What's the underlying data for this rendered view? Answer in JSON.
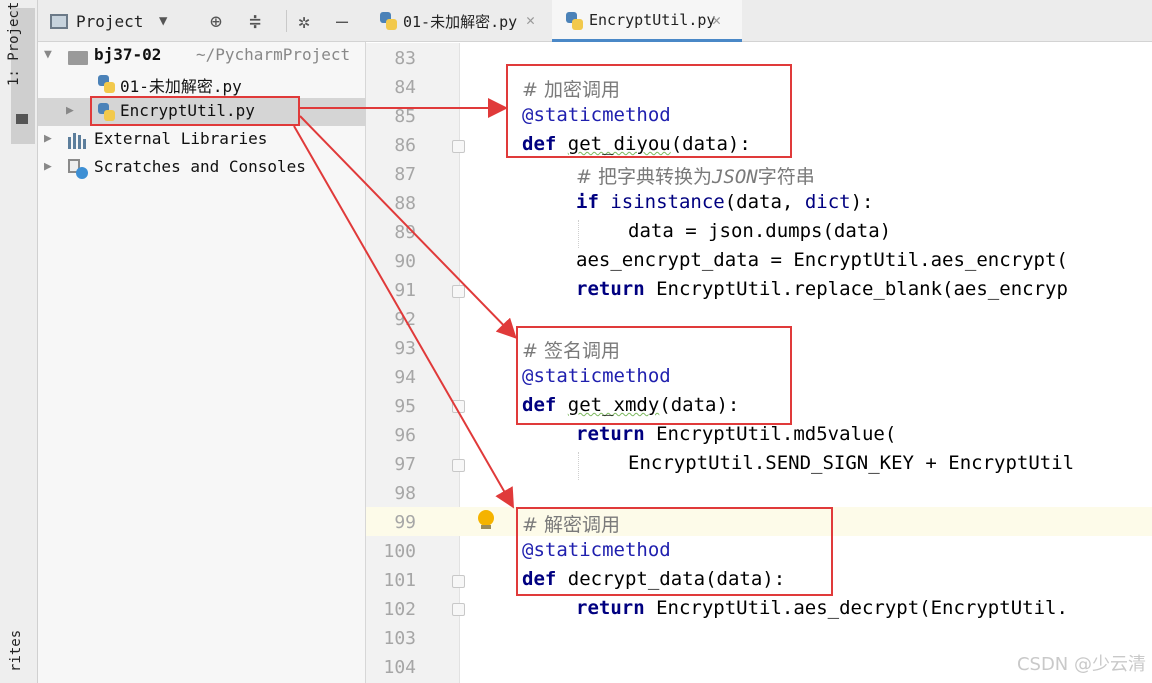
{
  "sidebar": {
    "project_tab": "1: Project",
    "favorites_tab": "rites"
  },
  "project_panel": {
    "title": "Project",
    "root_name": "bj37-02",
    "root_path": "~/PycharmProject",
    "files": [
      "01-未加解密.py",
      "EncryptUtil.py"
    ],
    "external_libraries": "External Libraries",
    "scratches": "Scratches and Consoles"
  },
  "tabs": [
    {
      "label": "01-未加解密.py"
    },
    {
      "label": "EncryptUtil.py"
    }
  ],
  "editor": {
    "line_numbers": [
      "83",
      "84",
      "85",
      "86",
      "87",
      "88",
      "89",
      "90",
      "91",
      "92",
      "93",
      "94",
      "95",
      "96",
      "97",
      "98",
      "99",
      "100",
      "101",
      "102",
      "103",
      "104"
    ],
    "lines": {
      "l84": "# 加密调用",
      "l85": "@staticmethod",
      "l86_kw": "def",
      "l86_name": "get_diyou",
      "l86_rest": "(data):",
      "l87_hash": "# ",
      "l87_a": "把字典转换为",
      "l87_json": "JSON",
      "l87_b": "字符串",
      "l88_kw": "if",
      "l88_fn": "isinstance",
      "l88_mid": "(data, ",
      "l88_type": "dict",
      "l88_end": "):",
      "l89": "data = json.dumps(data)",
      "l90": "aes_encrypt_data = EncryptUtil.aes_encrypt(",
      "l91_kw": "return",
      "l91_rest": " EncryptUtil.replace_blank(aes_encryp",
      "l93": "# 签名调用",
      "l94": "@staticmethod",
      "l95_kw": "def",
      "l95_name": "get_xmdy",
      "l95_rest": "(data):",
      "l96_kw": "return",
      "l96_rest": " EncryptUtil.md5value(",
      "l97": "EncryptUtil.SEND_SIGN_KEY + EncryptUtil",
      "l99": "# 解密调用",
      "l100": "@staticmethod",
      "l101_kw": "def",
      "l101_name": "decrypt_data",
      "l101_rest": "(data):",
      "l102_kw": "return",
      "l102_rest": " EncryptUtil.aes_decrypt(EncryptUtil.",
      "l90_cut": "",
      "l91_cut": ""
    }
  },
  "watermark": "CSDN @少云清",
  "colors": {
    "annotation": "#e03a3a",
    "keyword": "#000080",
    "decorator": "#1f1fae",
    "comment": "#7a7a7a"
  }
}
